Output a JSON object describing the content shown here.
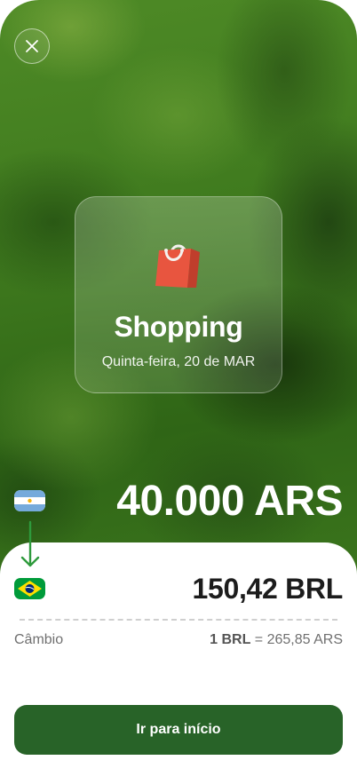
{
  "header": {
    "close_icon": "close-icon"
  },
  "category": {
    "icon": "shopping-bag-icon",
    "title": "Shopping",
    "date": "Quinta-feira, 20 de MAR"
  },
  "conversion": {
    "source_amount": "40.000 ARS",
    "source_flag": "argentina-flag-icon",
    "arrow_icon": "arrow-down-icon",
    "target_amount": "150,42 BRL",
    "target_flag": "brazil-flag-icon"
  },
  "exchange": {
    "label": "Câmbio",
    "rate_base": "1 BRL",
    "rate_equals": " = ",
    "rate_value": "265,85 ARS"
  },
  "actions": {
    "home_button": "Ir para início"
  },
  "colors": {
    "primary": "#286328",
    "arrow": "#2e9a3c",
    "text_dark": "#1c1c1c"
  }
}
